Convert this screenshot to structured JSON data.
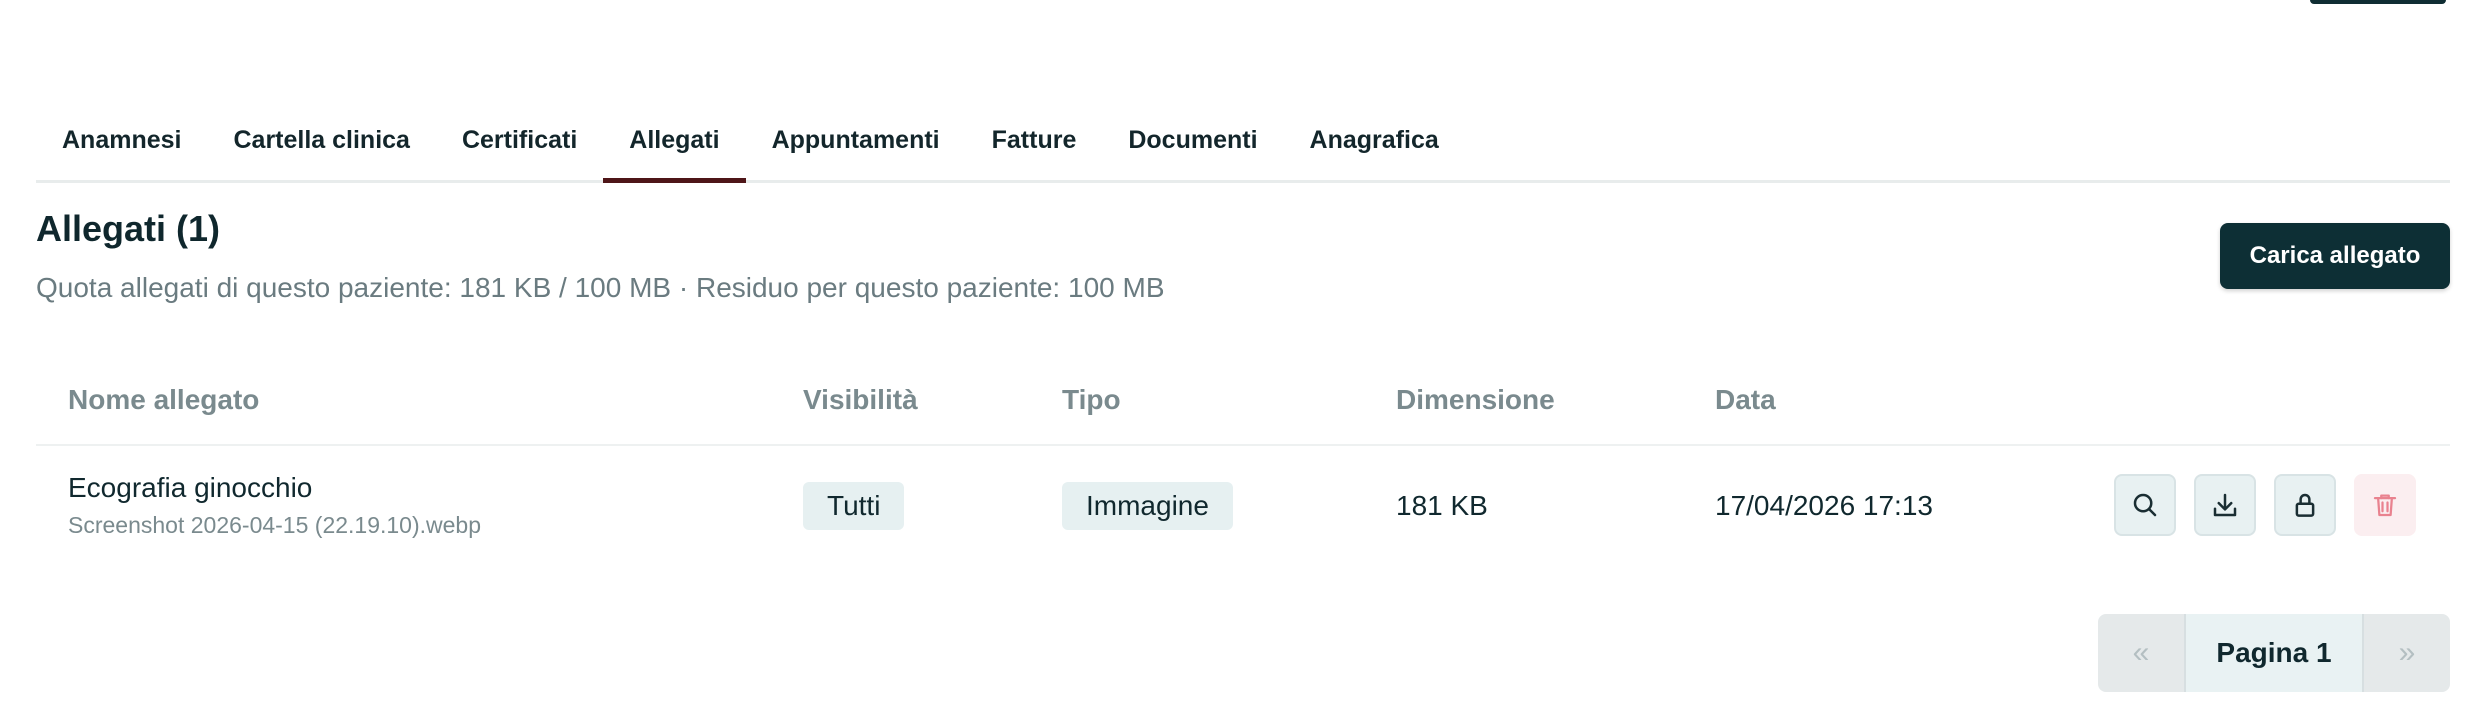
{
  "tabs": [
    {
      "label": "Anamnesi",
      "active": false
    },
    {
      "label": "Cartella clinica",
      "active": false
    },
    {
      "label": "Certificati",
      "active": false
    },
    {
      "label": "Allegati",
      "active": true
    },
    {
      "label": "Appuntamenti",
      "active": false
    },
    {
      "label": "Fatture",
      "active": false
    },
    {
      "label": "Documenti",
      "active": false
    },
    {
      "label": "Anagrafica",
      "active": false
    }
  ],
  "section": {
    "title": "Allegati (1)",
    "quota_text": "Quota allegati di questo paziente: 181 KB / 100 MB · Residuo per questo paziente: 100 MB",
    "upload_label": "Carica allegato"
  },
  "table": {
    "headers": [
      "Nome allegato",
      "Visibilità",
      "Tipo",
      "Dimensione",
      "Data"
    ],
    "rows": [
      {
        "name": "Ecografia ginocchio",
        "filename": "Screenshot 2026-04-15 (22.19.10).webp",
        "visibility": "Tutti",
        "type": "Immagine",
        "size": "181 KB",
        "date": "17/04/2026 17:13",
        "actions": [
          "search-icon",
          "download-icon",
          "lock-icon",
          "trash-icon"
        ]
      }
    ]
  },
  "pagination": {
    "prev": "«",
    "current": "Pagina 1",
    "next": "»"
  },
  "colors": {
    "primary": "#0d2f35",
    "active_tab_underline": "#4e1518",
    "danger": "#e9828f",
    "muted_text": "#7a8a8e"
  }
}
